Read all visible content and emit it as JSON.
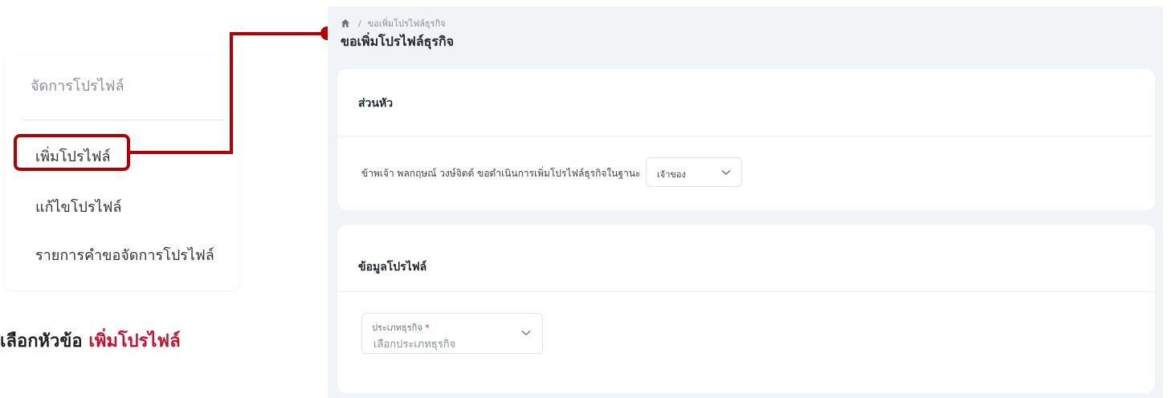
{
  "sidebar": {
    "title": "จัดการโปรไฟล์",
    "items": [
      {
        "label": "เพิ่มโปรไฟล์"
      },
      {
        "label": "แก้ไขโปรไฟล์"
      },
      {
        "label": "รายการคำขอจัดการโปรไฟล์"
      }
    ]
  },
  "caption": {
    "prefix": "เลือกหัวข้อ ",
    "highlight": "เพิ่มโปรไฟล์"
  },
  "breadcrumb": {
    "separator": "/",
    "current": "ขอเพิ่มโปรไฟล์ธุรกิจ"
  },
  "page": {
    "title": "ขอเพิ่มโปรไฟล์ธุรกิจ"
  },
  "header_card": {
    "title": "ส่วนหัว",
    "statement": "ข้าพเจ้า พลกฤษณ์ วงษ์จิตต์ ขอดำเนินการเพิ่มโปรไฟล์ธุรกิจในฐานะ",
    "role_selected": "เจ้าของ"
  },
  "profile_card": {
    "title": "ข้อมูลโปรไฟล์",
    "business_type_label": "ประเภทธุรกิจ",
    "required_mark": "*",
    "business_type_placeholder": "เลือกประเภทธุรกิจ"
  },
  "colors": {
    "accent": "#b40000",
    "caption_accent": "#c8102e",
    "page_bg": "#f1f3f6"
  }
}
